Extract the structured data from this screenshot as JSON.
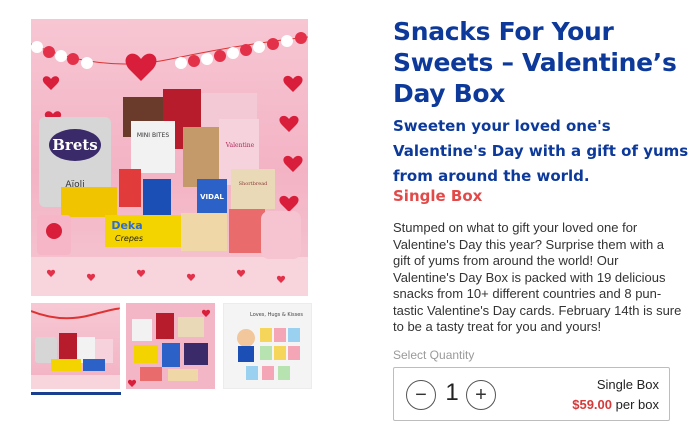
{
  "product": {
    "title": "Snacks For Your Sweets – Valentine’s Day Box",
    "subtitle": "Sweeten your loved one's Valentine's Day with a gift of yums from around the world.",
    "variant": "Single Box",
    "description": "Stumped on what to gift your loved one for Valentine's Day this year? Surprise them with a gift of yums from around the world! Our Valentine's Day Box is packed with 19 delicious snacks from 10+ different countries and 8 pun-tastic Valentine's Day cards. February 14th is sure to be a tasty treat for you and yours!"
  },
  "gallery": {
    "image_labels": {
      "brets": "Brets",
      "aioli": "Aïoli",
      "deka": "Deka",
      "crepes": "Crepes",
      "mini_bites": "MINI BITES",
      "vidal": "VIDAL",
      "valentine": "Valentine",
      "shortbread": "Shortbread"
    },
    "thumbnail_3_caption": "Loves, Hugs & Kisses",
    "selected_index": 0
  },
  "quantity": {
    "label": "Select Quantity",
    "value": "1",
    "minus": "−",
    "plus": "+",
    "option_name": "Single Box",
    "price": "$59.00",
    "price_suffix": "per box"
  },
  "colors": {
    "title": "#0d3a9a",
    "variant": "#e24a4a",
    "price": "#d43a3a",
    "active_thumb": "#1a3f8f"
  }
}
